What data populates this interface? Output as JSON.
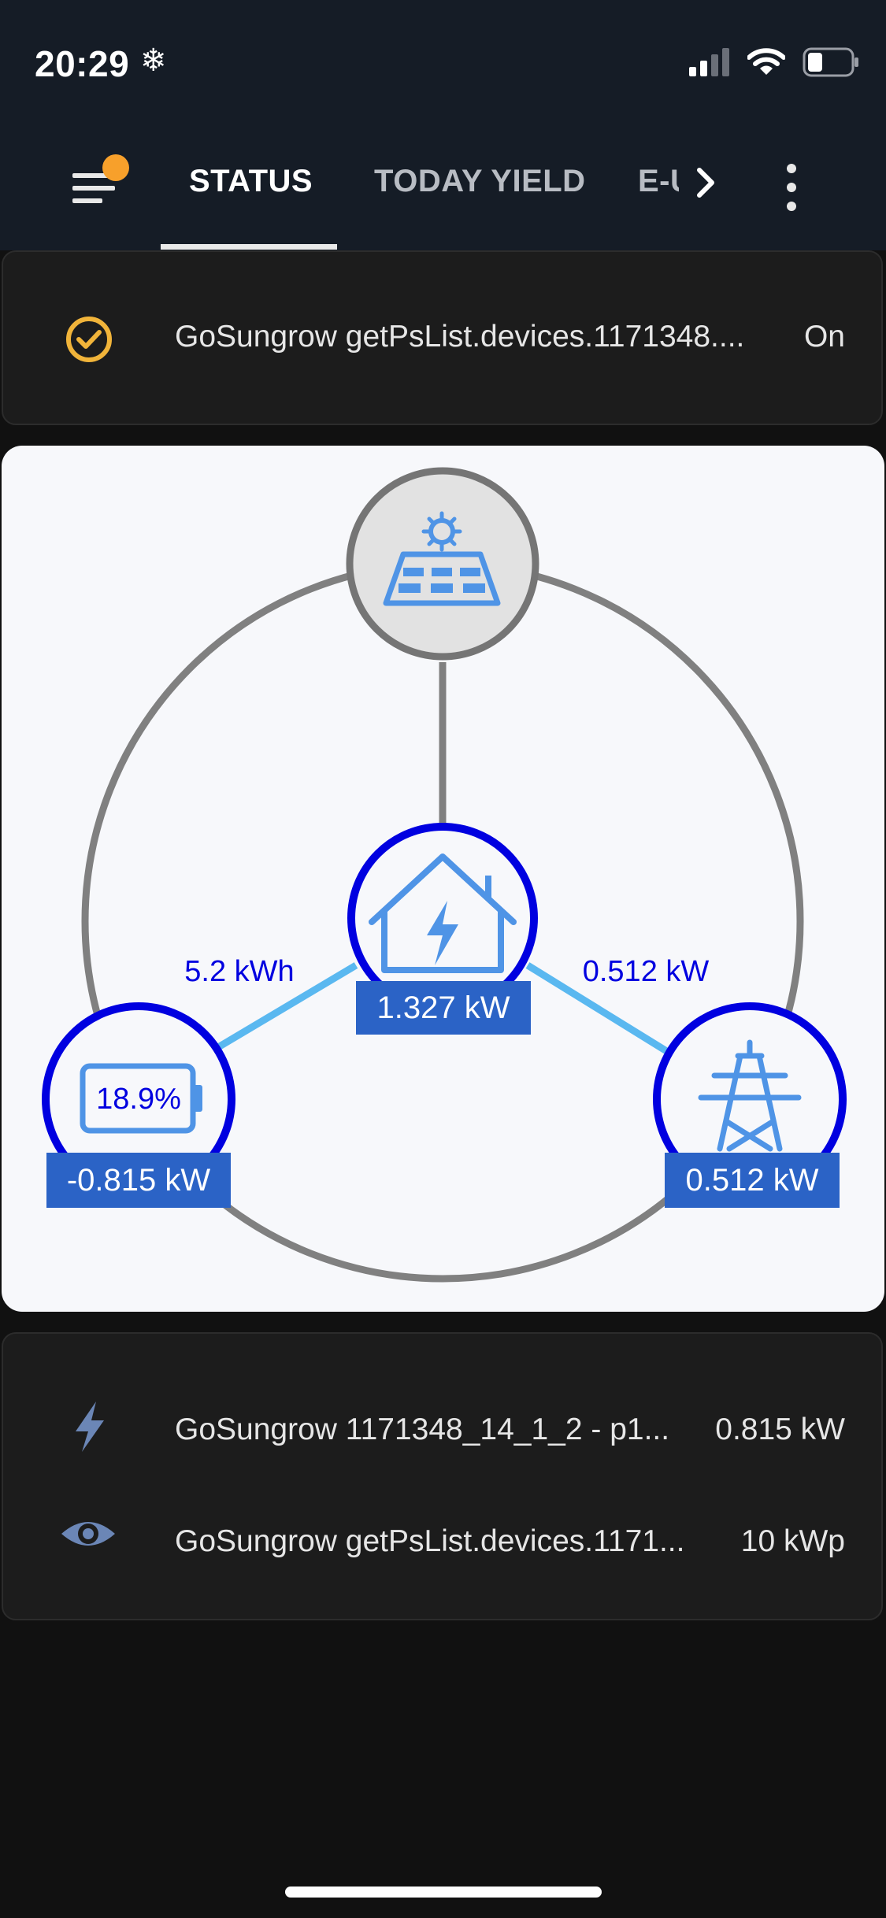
{
  "status_bar": {
    "time": "20:29",
    "weather_glyph": "❄"
  },
  "tabs": [
    {
      "label": "STATUS",
      "active": true
    },
    {
      "label": "TODAY YIELD",
      "active": false
    },
    {
      "label": "E-U",
      "active": false
    }
  ],
  "switch_row": {
    "label": "GoSungrow getPsList.devices.1171348....",
    "value": "On",
    "icon": "check-circle-icon",
    "icon_color": "#f1b43a"
  },
  "power_flow": {
    "solar_icon": "solar-panel-icon",
    "home_power": "1.327 kW",
    "battery_percent": "18.9%",
    "battery_power": "-0.815 kW",
    "battery_energy": "5.2 kWh",
    "grid_power": "0.512 kW",
    "grid_flow_label": "0.512 kW",
    "colors": {
      "ring": "#0000e0",
      "label_bg": "#2b63c6",
      "flow_line": "#5ab8f0",
      "outer": "#808080"
    }
  },
  "entities": [
    {
      "icon": "lightning-icon",
      "label": "GoSungrow 1171348_14_1_2 - p1...",
      "value": "0.815 kW"
    },
    {
      "icon": "eye-icon",
      "label": "GoSungrow getPsList.devices.1171...",
      "value": "10 kWp"
    }
  ]
}
